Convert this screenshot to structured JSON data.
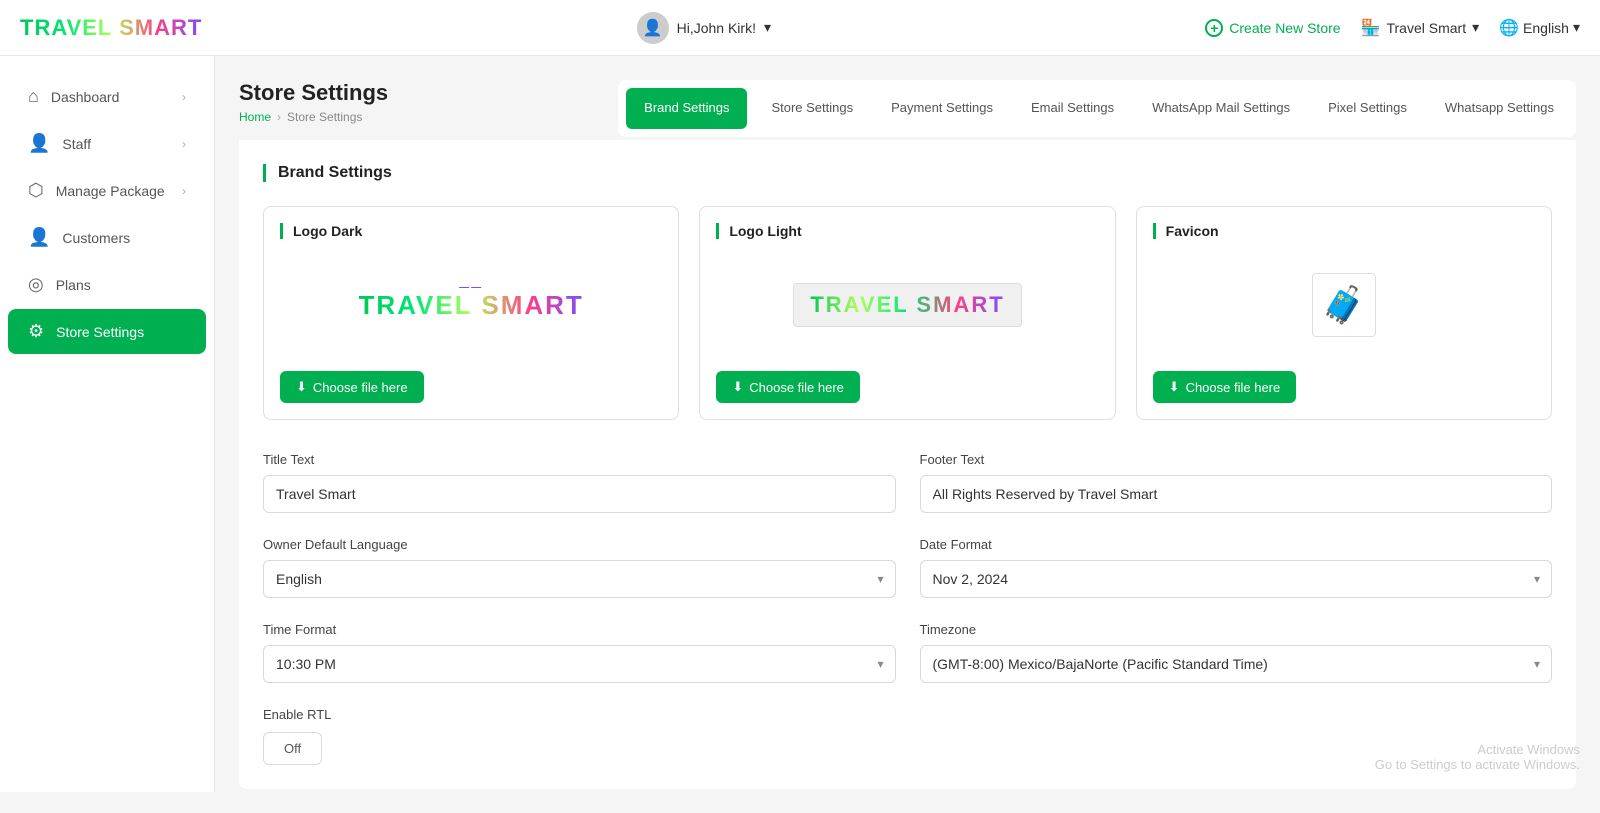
{
  "topnav": {
    "logo": "TRAVEL SMART",
    "user": {
      "greeting": "Hi,John Kirk!",
      "chevron": "▾"
    },
    "create_store": "Create New Store",
    "store_name": "Travel Smart",
    "language": "English",
    "chevron": "▾"
  },
  "sidebar": {
    "items": [
      {
        "id": "dashboard",
        "label": "Dashboard",
        "icon": "⌂",
        "has_arrow": true
      },
      {
        "id": "staff",
        "label": "Staff",
        "icon": "👤",
        "has_arrow": true
      },
      {
        "id": "manage-package",
        "label": "Manage Package",
        "icon": "⬡",
        "has_arrow": true
      },
      {
        "id": "customers",
        "label": "Customers",
        "icon": "👤",
        "has_arrow": false
      },
      {
        "id": "plans",
        "label": "Plans",
        "icon": "◎",
        "has_arrow": false
      },
      {
        "id": "store-settings",
        "label": "Store Settings",
        "icon": "⚙",
        "has_arrow": false,
        "active": true
      }
    ]
  },
  "page": {
    "title": "Store Settings",
    "breadcrumb_home": "Home",
    "breadcrumb_current": "Store Settings"
  },
  "tabs": [
    {
      "id": "brand-settings",
      "label": "Brand Settings",
      "active": true
    },
    {
      "id": "store-settings",
      "label": "Store Settings",
      "active": false
    },
    {
      "id": "payment-settings",
      "label": "Payment Settings",
      "active": false
    },
    {
      "id": "email-settings",
      "label": "Email Settings",
      "active": false
    },
    {
      "id": "whatsapp-mail-settings",
      "label": "WhatsApp Mail Settings",
      "active": false
    },
    {
      "id": "pixel-settings",
      "label": "Pixel Settings",
      "active": false
    },
    {
      "id": "whatsapp-settings",
      "label": "Whatsapp Settings",
      "active": false
    }
  ],
  "brand_settings": {
    "section_title": "Brand Settings",
    "logo_dark": {
      "title": "Logo Dark",
      "choose_file_btn": "Choose file here"
    },
    "logo_light": {
      "title": "Logo Light",
      "choose_file_btn": "Choose file here"
    },
    "favicon": {
      "title": "Favicon",
      "choose_file_btn": "Choose file here"
    },
    "title_text_label": "Title Text",
    "title_text_value": "Travel Smart",
    "footer_text_label": "Footer Text",
    "footer_text_value": "All Rights Reserved by Travel Smart",
    "owner_default_language_label": "Owner Default Language",
    "owner_default_language_value": "English",
    "date_format_label": "Date Format",
    "date_format_value": "Nov 2, 2024",
    "time_format_label": "Time Format",
    "time_format_value": "10:30 PM",
    "timezone_label": "Timezone",
    "timezone_value": "(GMT-8:00) Mexico/BajaNorte (Pacific Standard Time)",
    "enable_rtl_label": "Enable RTL",
    "rtl_toggle_label": "Off"
  },
  "windows_watermark": {
    "line1": "Activate Windows",
    "line2": "Go to Settings to activate Windows."
  }
}
